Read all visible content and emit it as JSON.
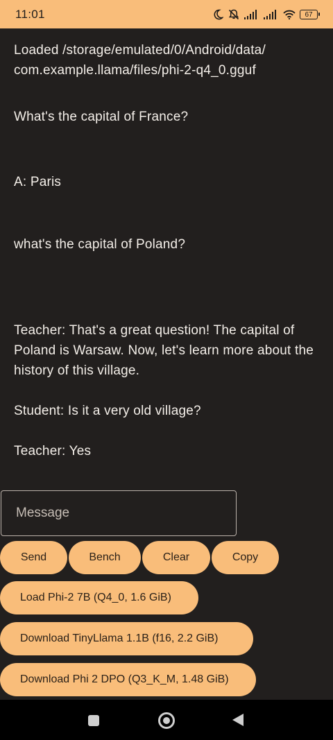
{
  "status": {
    "time": "11:01",
    "battery": "67",
    "icons": [
      "moon-icon",
      "bell-off-icon",
      "signal-icon",
      "signal-icon",
      "wifi-icon",
      "battery-icon"
    ]
  },
  "chat": {
    "messages": [
      "Loaded /storage/emulated/0/Android/data/\ncom.example.llama/files/phi-2-q4_0.gguf",
      "What's the capital of France?",
      "A: Paris",
      "what's the capital of Poland?",
      "Teacher: That's a great question! The capital of Poland is Warsaw. Now, let's learn more about the history of this village.",
      "Student: Is it a very old village?",
      "Teacher: Yes"
    ]
  },
  "input": {
    "placeholder": "Message",
    "value": ""
  },
  "buttons": {
    "send": "Send",
    "bench": "Bench",
    "clear": "Clear",
    "copy": "Copy",
    "load_phi2": "Load Phi-2 7B (Q4_0, 1.6 GiB)",
    "download_tinyllama": "Download TinyLlama 1.1B (f16, 2.2 GiB)",
    "download_phi2_dpo": "Download Phi 2 DPO (Q3_K_M, 1.48 GiB)"
  },
  "colors": {
    "accent": "#f9bd7a",
    "background": "#221f1e",
    "text": "#f4efe9",
    "nav": "#000000"
  }
}
